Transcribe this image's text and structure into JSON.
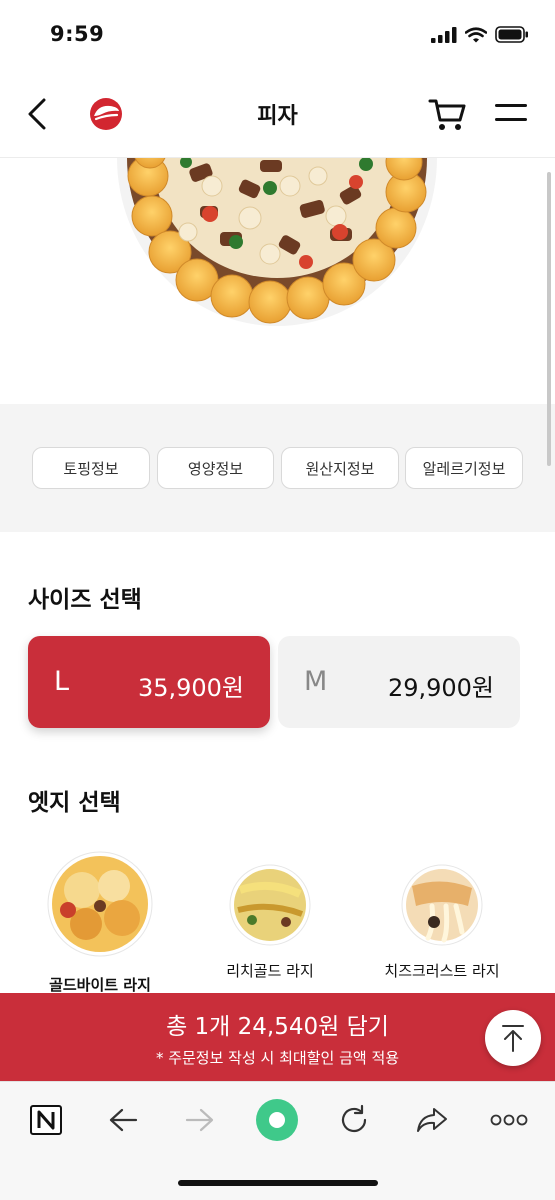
{
  "status": {
    "time": "9:59"
  },
  "header": {
    "title": "피자"
  },
  "info_tabs": [
    "토핑정보",
    "영양정보",
    "원산지정보",
    "알레르기정보"
  ],
  "size_section": {
    "title": "사이즈 선택",
    "options": [
      {
        "letter": "L",
        "price": "35,900원",
        "selected": true
      },
      {
        "letter": "M",
        "price": "29,900원",
        "selected": false
      }
    ]
  },
  "edge_section": {
    "title": "엣지 선택",
    "options": [
      {
        "label": "골드바이트 라지",
        "selected": true
      },
      {
        "label": "리치골드 라지",
        "selected": false
      },
      {
        "label": "치즈크러스트 라지",
        "selected": false
      }
    ]
  },
  "cta": {
    "main": "총 1개 24,540원 담기",
    "sub": "* 주문정보 작성 시 최대할인 금액 적용"
  },
  "colors": {
    "brand": "#c92e3a",
    "selected_card": "#c92e3a",
    "unselected_card": "#f2f2f2",
    "band": "#f4f4f4",
    "browser_green": "#3fc98a"
  },
  "icons": [
    "back-arrow-icon",
    "pizza-hut-logo-icon",
    "cart-icon",
    "hamburger-menu-icon",
    "scroll-to-top-icon",
    "naver-n-icon",
    "browser-back-icon",
    "browser-forward-icon",
    "green-home-icon",
    "reload-icon",
    "share-icon",
    "more-icon"
  ]
}
